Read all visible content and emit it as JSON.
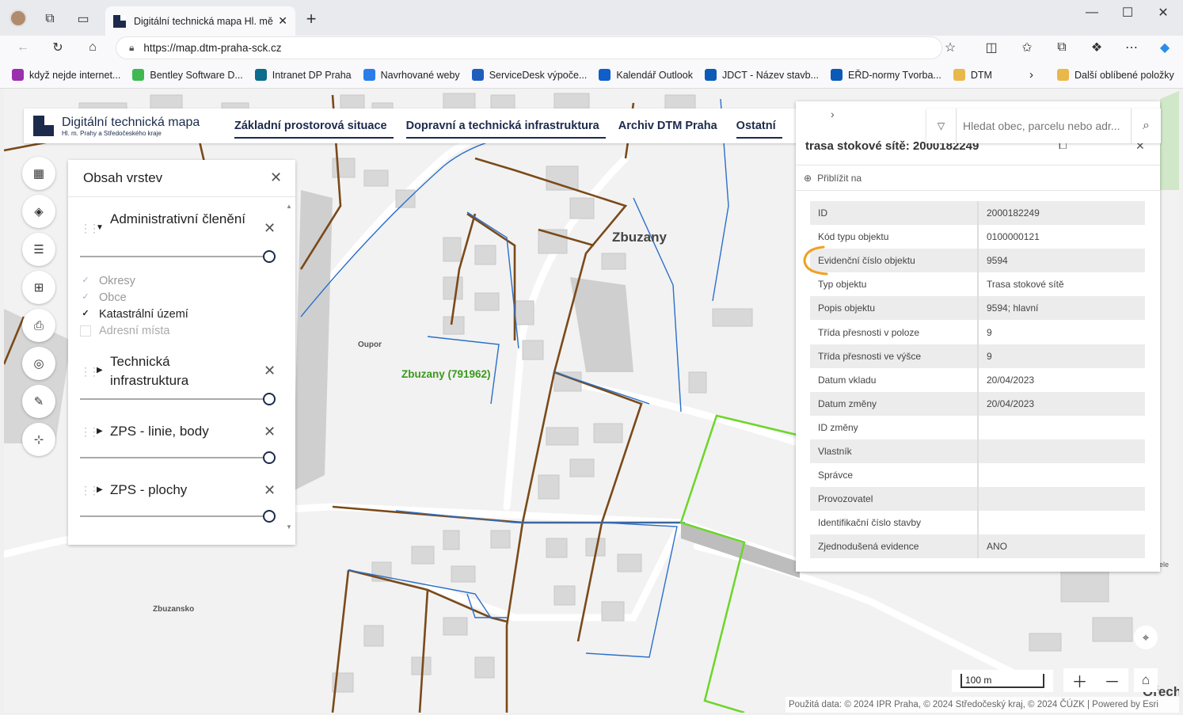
{
  "browser": {
    "tab_title": "Digitální technická mapa Hl. měs",
    "url": "https://map.dtm-praha-sck.cz",
    "favorites": [
      {
        "label": "když nejde internet...",
        "color": "#9b2fae"
      },
      {
        "label": "Bentley Software D...",
        "color": "#3fb950"
      },
      {
        "label": "Intranet DP Praha",
        "color": "#0d6b8c"
      },
      {
        "label": "Navrhované weby",
        "color": "#2b7de9"
      },
      {
        "label": "ServiceDesk výpoče...",
        "color": "#1f5ebd"
      },
      {
        "label": "Kalendář Outlook",
        "color": "#0f5ec9"
      },
      {
        "label": "JDCT - Název stavb...",
        "color": "#0a5ab8"
      },
      {
        "label": "EŘD-normy Tvorba...",
        "color": "#0a5ab8"
      },
      {
        "label": "DTM",
        "color": "#e8b84a"
      }
    ],
    "other_favorites": "Další oblíbené položky"
  },
  "app": {
    "logo_title": "Digitální technická mapa",
    "logo_subtitle": "Hl. m. Prahy a Středočeského kraje",
    "nav": [
      "Základní prostorová situace",
      "Dopravní a technická infrastruktura",
      "Archiv DTM Praha",
      "Ostatní"
    ],
    "search_placeholder": "Hledat obec, parcelu nebo adr..."
  },
  "layers_panel": {
    "title": "Obsah vrstev",
    "groups": [
      {
        "title": "Administrativní členění",
        "expanded": true
      },
      {
        "title": "Technická infrastruktura",
        "expanded": false
      },
      {
        "title": "ZPS - linie, body",
        "expanded": false
      },
      {
        "title": "ZPS - plochy",
        "expanded": false
      }
    ],
    "admin_items": [
      {
        "label": "Okresy",
        "checked": true,
        "enabled": false
      },
      {
        "label": "Obce",
        "checked": true,
        "enabled": false
      },
      {
        "label": "Katastrální území",
        "checked": true,
        "enabled": true
      },
      {
        "label": "Adresní místa",
        "checked": false,
        "enabled": false
      }
    ]
  },
  "popup": {
    "title": "trasa stokové sítě: 2000182249",
    "zoom_to": "Přiblížit na",
    "attributes": [
      {
        "key": "ID",
        "value": "2000182249"
      },
      {
        "key": "Kód typu objektu",
        "value": "0100000121"
      },
      {
        "key": "Evidenční číslo objektu",
        "value": "9594"
      },
      {
        "key": "Typ objektu",
        "value": "Trasa stokové sítě"
      },
      {
        "key": "Popis objektu",
        "value": "9594; hlavní"
      },
      {
        "key": "Třída přesnosti v poloze",
        "value": "9"
      },
      {
        "key": "Třída přesnosti ve výšce",
        "value": "9"
      },
      {
        "key": "Datum vkladu",
        "value": "20/04/2023"
      },
      {
        "key": "Datum změny",
        "value": "20/04/2023"
      },
      {
        "key": "ID změny",
        "value": ""
      },
      {
        "key": "Vlastník",
        "value": ""
      },
      {
        "key": "Správce",
        "value": ""
      },
      {
        "key": "Provozovatel",
        "value": ""
      },
      {
        "key": "Identifikační číslo stavby",
        "value": ""
      },
      {
        "key": "Zjednodušená evidence",
        "value": "ANO"
      }
    ]
  },
  "map": {
    "labels": {
      "zbuzany": "Zbuzany",
      "cadastral": "Zbuzany (791962)",
      "oupor": "Oupor",
      "zbuzansko": "Zbuzansko",
      "orech": "Ořech",
      "edge": "ele"
    },
    "scale": "100 m",
    "attribution": "Použitá data: © 2024 IPR Praha, © 2024 Středočeský kraj, © 2024 ČÚZK | Powered by Esri"
  }
}
